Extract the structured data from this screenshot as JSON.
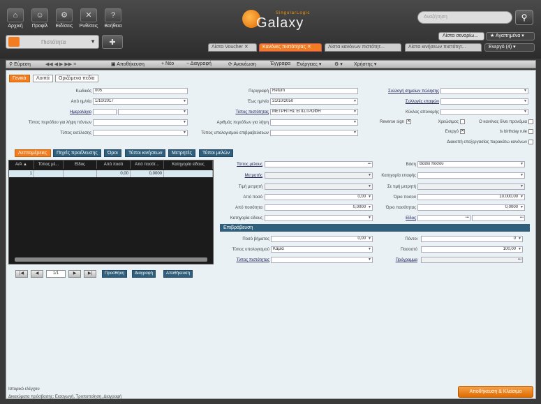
{
  "nav": {
    "home": "Αρχική",
    "profile": "Προφίλ",
    "notif": "Ειδ/σεις",
    "settings": "Ρυθ/σεις",
    "help": "Βοήθεια"
  },
  "logo": {
    "text": "Galaxy",
    "brand": "SingularLogic"
  },
  "search": {
    "placeholder": "Αναζήτηση"
  },
  "module_combo": "Πιστότητα",
  "top_right": {
    "scenarios": "Λίστα σεναρίω...",
    "favorites": "★ Αγαπημένα ▾",
    "active": "Ενεργό (4) ▾"
  },
  "tabs": [
    "Λίστα Voucher",
    "Κανόνες πιστότητας",
    "Λίστα κανόνων πιστότητ...",
    "Λίστα κινήσεων πιστότητ..."
  ],
  "toolbar": {
    "find": "Εύρεση",
    "save": "Αποθήκευση",
    "new": "Νέο",
    "delete": "Διαγραφή",
    "refresh": "Ανανέωση",
    "documents": "Έγγραφα",
    "actions": "Ενέργειες ▾",
    "user": "Χρήστης ▾"
  },
  "form_tabs": {
    "general": "Γενικά",
    "other": "Λοιπά",
    "custom": "Οριζόμενα πεδία"
  },
  "general": {
    "code_lbl": "Κωδικός",
    "code": "005",
    "from_date_lbl": "Από ημ/νία",
    "from_date": "1/10/2017",
    "calendar_lbl": "Ημερολόγιο",
    "period_type_lbl": "Τύπος περιόδου για λήψη πόντων",
    "exec_type_lbl": "Τύπος εκτέλεσης",
    "desc_lbl": "Περιγραφή",
    "desc": "Return",
    "to_date_lbl": "Έως ημ/νία",
    "to_date": "31/10/2050",
    "loyalty_type_lbl": "Τύπος πιστότητας",
    "loyalty_type": "ΜΕΤΡΗΤΗΣ ΕΠΙΣΤΡΟΦΗ",
    "period_count_lbl": "Αριθμός περιόδων για λήψη",
    "reward_calc_lbl": "Τύπος υπολογισμού επιβραβεύσεων",
    "sales_points_lbl": "Συλλογή σημείων πώλησης",
    "contacts_lbl": "Συλλογές επαφών",
    "redemption_lbl": "Κύκλος απονομής",
    "reverse_lbl": "Reverse sign",
    "debit_lbl": "Χρεώσιμος",
    "privilege_lbl": "Ο κανόνας δίνει προνόμια",
    "active_lbl": "Ενεργό",
    "birthday_lbl": "Is birthday rule",
    "stop_lbl": "Διακοπή επεξεργασίας παρακάτω κανόνων"
  },
  "sub_tabs": [
    "Λεπτομέρειες",
    "Πηγές προέλευσης",
    "Όροι",
    "Τύποι κινήσεων",
    "Μετρητές",
    "Τύποι μελών"
  ],
  "grid": {
    "headers": [
      "Α/Α ▲",
      "Τύπος μέ...",
      "Είδος",
      "Από ποσό",
      "Από ποσότ...",
      "Κατηγορία είδους"
    ],
    "rows": [
      [
        "1",
        "",
        "",
        "0,00",
        "0,0000",
        ""
      ]
    ]
  },
  "pager": {
    "page": "1/1",
    "add": "Προσθήκη",
    "delete": "Διαγραφή",
    "save": "Αποθήκευση"
  },
  "detail": {
    "member_type_lbl": "Τύπος μέλους",
    "counter_lbl": "Μετρητής",
    "counter_value_lbl": "Τιμή μετρητή",
    "from_amount_lbl": "Από ποσό",
    "from_amount": "0,00",
    "from_qty_lbl": "Από ποσότητα",
    "from_qty": "0,0000",
    "item_cat_lbl": "Κατηγορία είδους",
    "base_lbl": "Βάση",
    "base": "Βάσει ποσού",
    "contact_cat_lbl": "Κατηγορία επαφής",
    "counter_val2_lbl": "Σε τιμή μετρητή",
    "amount_limit_lbl": "Όριο ποσού",
    "amount_limit": "10.000,00",
    "qty_limit_lbl": "Όριο ποσότητας",
    "qty_limit": "0,0000",
    "item_lbl": "Είδος"
  },
  "reward": {
    "title": "Επιβράβευση",
    "step_lbl": "Ποσό βήματος",
    "step": "0,00",
    "calc_type_lbl": "Τύπος υπολογισμού",
    "calc_type": "Καμία",
    "loyalty_type_lbl": "Τύπος πιστότητας",
    "points_lbl": "Πόντοι",
    "points": "0",
    "percent_lbl": "Ποσοστό",
    "percent": "100,00",
    "program_lbl": "Πρόγραμμα"
  },
  "footer": {
    "history": "Ιστορικό ελέγχου",
    "rights": "Δικαιώματα πρόσβασης: Εισαγωγή, Τροποποίηση, Διαγραφή",
    "save_close": "Αποθήκευση & Κλείσιμο"
  }
}
